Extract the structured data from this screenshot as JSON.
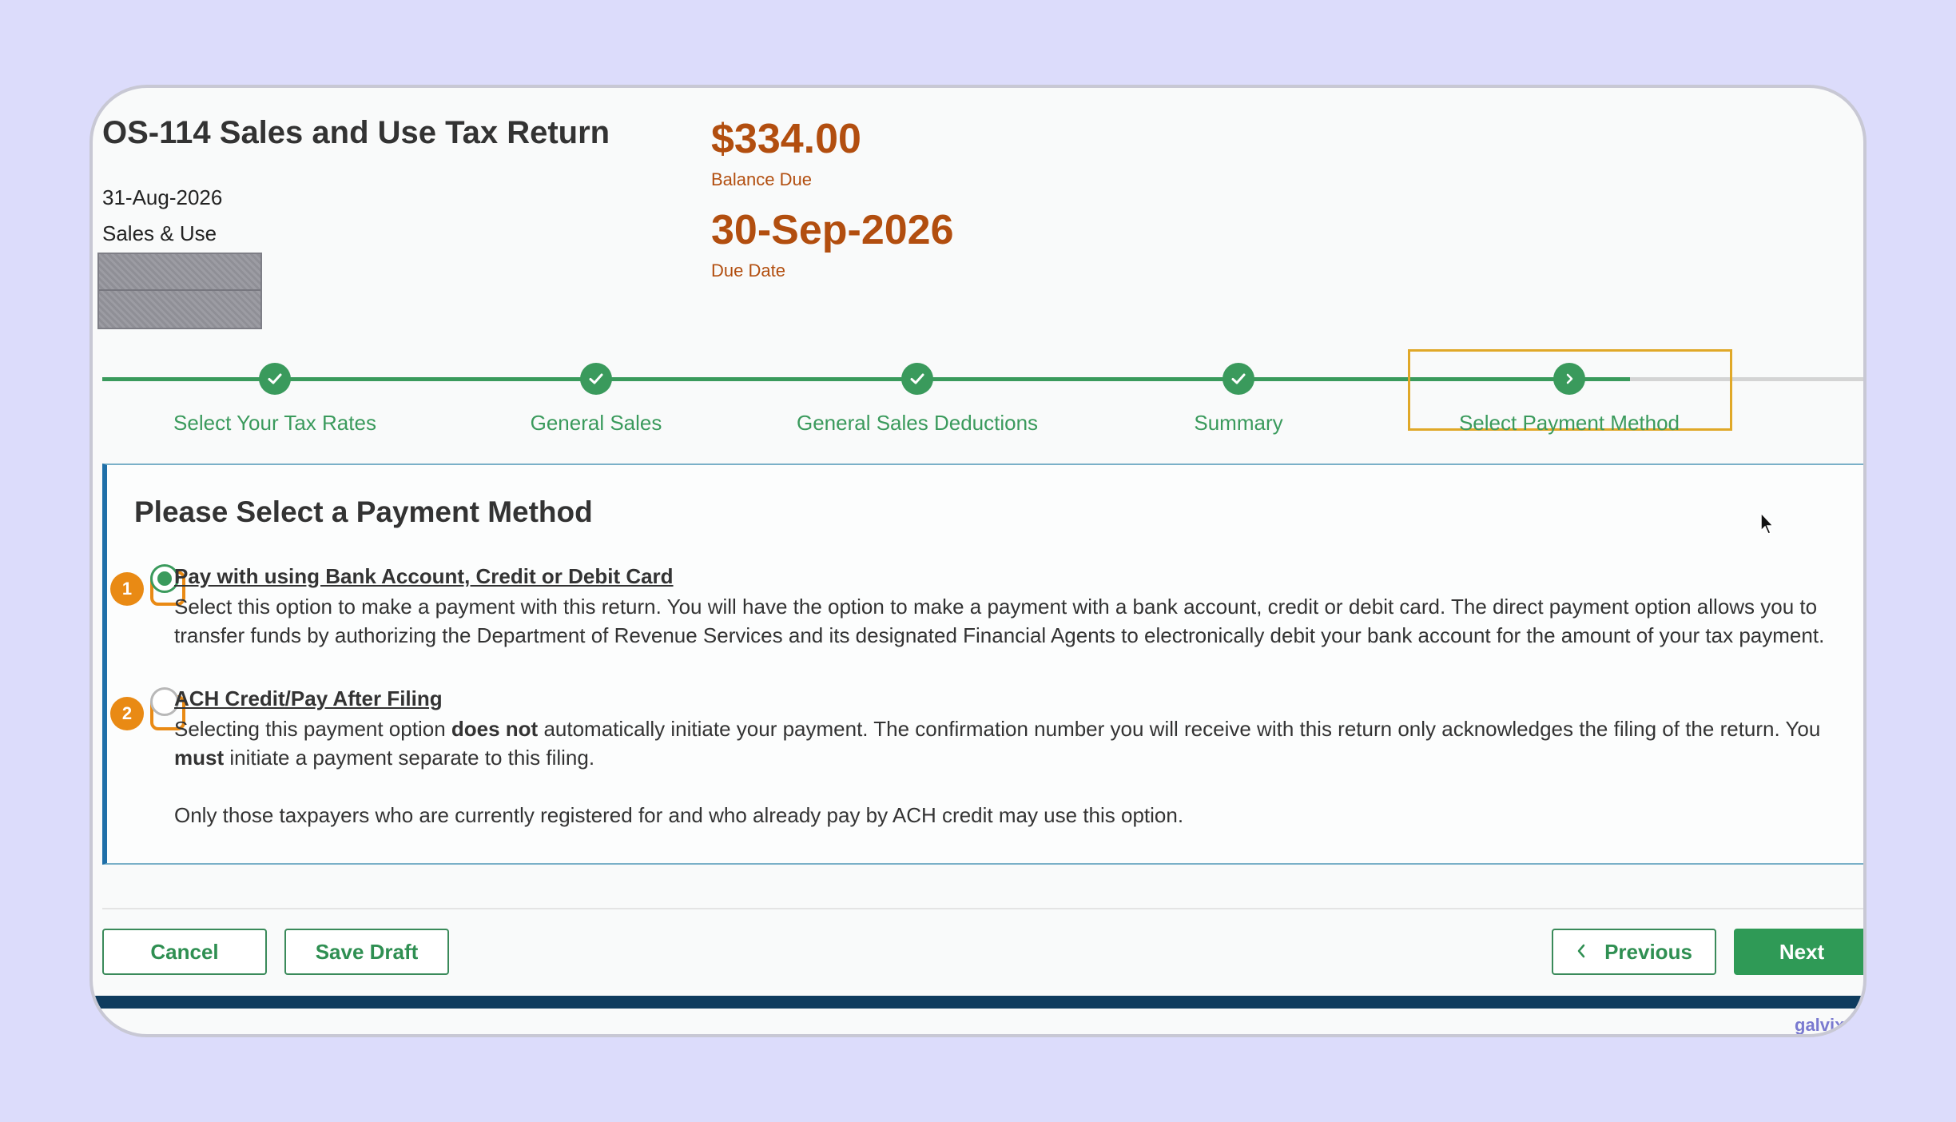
{
  "header": {
    "title": "OS-114 Sales and Use Tax Return",
    "period_date": "31-Aug-2026",
    "tax_type": "Sales & Use",
    "balance_amount": "$334.00",
    "balance_label": "Balance Due",
    "due_date": "30-Sep-2026",
    "due_label": "Due Date"
  },
  "stepper": {
    "steps": [
      {
        "label": "Select Your Tax Rates",
        "status": "complete"
      },
      {
        "label": "General Sales",
        "status": "complete"
      },
      {
        "label": "General Sales Deductions",
        "status": "complete"
      },
      {
        "label": "Summary",
        "status": "complete"
      },
      {
        "label": "Select Payment Method",
        "status": "current"
      }
    ]
  },
  "payment": {
    "title": "Please Select a Payment Method",
    "options": [
      {
        "badge": "1",
        "title": "Pay with using Bank Account, Credit or Debit Card",
        "description": "Select this option to make a payment with this return. You will have the option to make a payment with a bank account, credit or debit card. The direct payment option allows you to transfer funds by authorizing the Department of Revenue Services and its designated Financial Agents to electronically debit your bank account for the amount of your tax payment.",
        "selected": true
      },
      {
        "badge": "2",
        "title": "ACH Credit/Pay After Filing",
        "desc_part1": "Selecting this payment option ",
        "desc_bold1": "does not",
        "desc_part2": " automatically initiate your payment. The confirmation number you will receive with this return only acknowledges the filing of the return. You ",
        "desc_bold2": "must",
        "desc_part3": " initiate a payment separate to this filing.",
        "note": "Only those taxpayers who are currently registered for and who already pay by ACH credit may use this option.",
        "selected": false
      }
    ]
  },
  "footer": {
    "cancel": "Cancel",
    "save_draft": "Save Draft",
    "previous": "Previous",
    "next": "Next"
  },
  "watermark": "galvix",
  "colors": {
    "accent_green": "#3a9a5c",
    "amount_orange": "#b24e0f",
    "highlight_orange": "#e98a14",
    "panel_blue": "#1f6fa8"
  }
}
